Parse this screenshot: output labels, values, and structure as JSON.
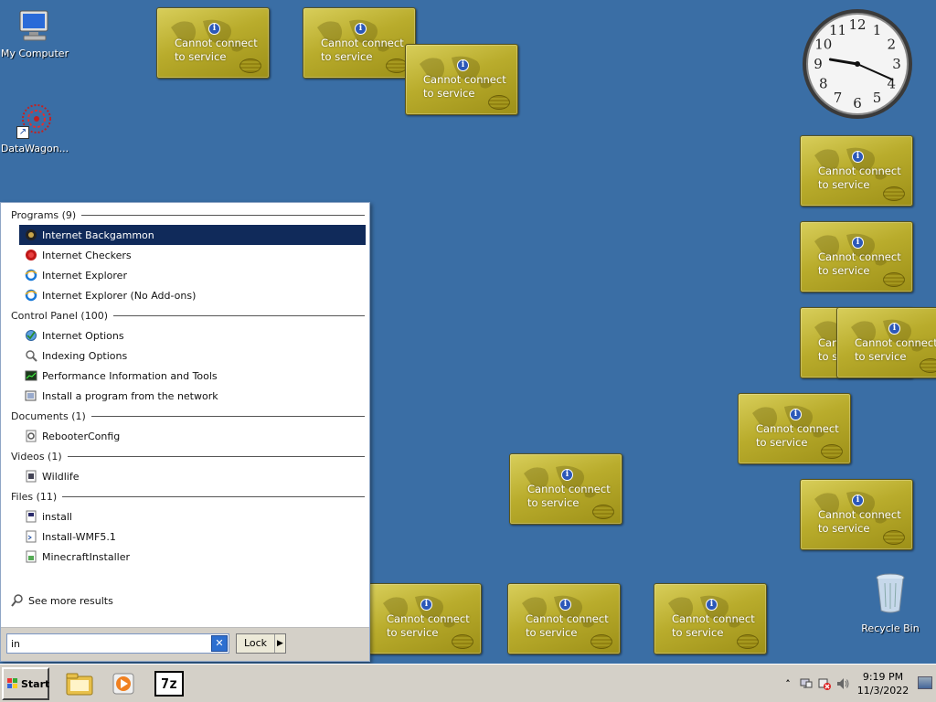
{
  "desktop": {
    "icons": [
      {
        "label": "My Computer",
        "icon": "computer-icon"
      },
      {
        "label": "DataWagon...",
        "icon": "datawagon-icon"
      }
    ],
    "recycle_bin": {
      "label": "Recycle Bin",
      "icon": "recycle-bin-icon"
    }
  },
  "gadget": {
    "message": "Cannot connect\nto service",
    "info_symbol": "i"
  },
  "clock_gadget": {
    "numbers": [
      "12",
      "1",
      "2",
      "3",
      "4",
      "5",
      "6",
      "7",
      "8",
      "9",
      "10",
      "11"
    ],
    "hour": 9,
    "minute": 19
  },
  "start_menu": {
    "groups": [
      {
        "title": "Programs (9)",
        "items": [
          {
            "label": "Internet Backgammon",
            "icon": "backgammon-icon",
            "selected": true
          },
          {
            "label": "Internet Checkers",
            "icon": "checkers-icon"
          },
          {
            "label": "Internet Explorer",
            "icon": "ie-icon"
          },
          {
            "label": "Internet Explorer (No Add-ons)",
            "icon": "ie-icon"
          }
        ]
      },
      {
        "title": "Control Panel (100)",
        "items": [
          {
            "label": "Internet Options",
            "icon": "internet-options-icon"
          },
          {
            "label": "Indexing Options",
            "icon": "indexing-icon"
          },
          {
            "label": "Performance Information and Tools",
            "icon": "performance-icon"
          },
          {
            "label": "Install a program from the network",
            "icon": "install-network-icon"
          }
        ]
      },
      {
        "title": "Documents (1)",
        "items": [
          {
            "label": "RebooterConfig",
            "icon": "config-file-icon"
          }
        ]
      },
      {
        "title": "Videos (1)",
        "items": [
          {
            "label": "Wildlife",
            "icon": "video-file-icon"
          }
        ]
      },
      {
        "title": "Files (11)",
        "items": [
          {
            "label": "install",
            "icon": "script-file-icon"
          },
          {
            "label": "Install-WMF5.1",
            "icon": "ps-file-icon"
          },
          {
            "label": "MinecraftInstaller",
            "icon": "installer-file-icon"
          }
        ]
      }
    ],
    "see_more": "See more results",
    "search": {
      "value": "in"
    },
    "lock_label": "Lock",
    "lock_arrow": "▶"
  },
  "taskbar": {
    "start_label": "Start",
    "pinned": [
      {
        "name": "explorer-icon"
      },
      {
        "name": "media-player-icon"
      },
      {
        "name": "7zip-icon",
        "text": "7z"
      }
    ],
    "tray": {
      "expand": "˄",
      "time": "9:19 PM",
      "date": "11/3/2022"
    }
  },
  "colors": {
    "desktop": "#3a6ea5",
    "selection": "#102a5a",
    "gadget": "#c2b534"
  }
}
